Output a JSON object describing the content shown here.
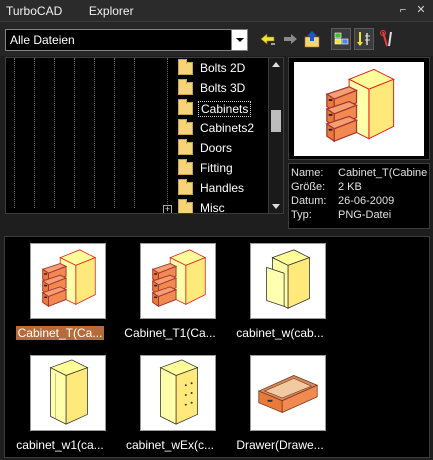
{
  "window": {
    "title": "TurboCAD        Explorer",
    "pin_glyph": "⌐",
    "close_glyph": "✕"
  },
  "toolbar": {
    "filter_value": "Alle Dateien",
    "tools": [
      "back-arrow-icon",
      "forward-arrow-icon",
      "up-folder-icon",
      "thumbnail-view-icon",
      "sort-icon",
      "tools-icon"
    ]
  },
  "tree": {
    "expand_glyph": "+",
    "items": [
      {
        "label": "Bolts 2D"
      },
      {
        "label": "Bolts 3D"
      },
      {
        "label": "Cabinets"
      },
      {
        "label": "Cabinets2"
      },
      {
        "label": "Doors"
      },
      {
        "label": "Fitting"
      },
      {
        "label": "Handles"
      },
      {
        "label": "Misc"
      }
    ]
  },
  "info": {
    "rows": [
      {
        "key": "Name:",
        "value": "Cabinet_T(Cabine"
      },
      {
        "key": "Größe:",
        "value": "2 KB"
      },
      {
        "key": "Datum:",
        "value": "26-06-2009"
      },
      {
        "key": "Typ:",
        "value": "PNG-Datei"
      }
    ]
  },
  "files": [
    {
      "name": "Cabinet_T(Ca...",
      "icon": "cabinet-drawers"
    },
    {
      "name": "Cabinet_T1(Ca...",
      "icon": "cabinet-drawers"
    },
    {
      "name": "cabinet_w(cab...",
      "icon": "cabinet-door"
    },
    {
      "name": "cabinet_w1(ca...",
      "icon": "cabinet-tall"
    },
    {
      "name": "cabinet_wEx(c...",
      "icon": "cabinet-tall-dots"
    },
    {
      "name": "Drawer(Drawe...",
      "icon": "drawer"
    }
  ],
  "colors": {
    "selection": "#b86b3a",
    "folder": "#f6d57a",
    "cabinet_face": "#ffff99",
    "drawer": "#e87a3a"
  }
}
